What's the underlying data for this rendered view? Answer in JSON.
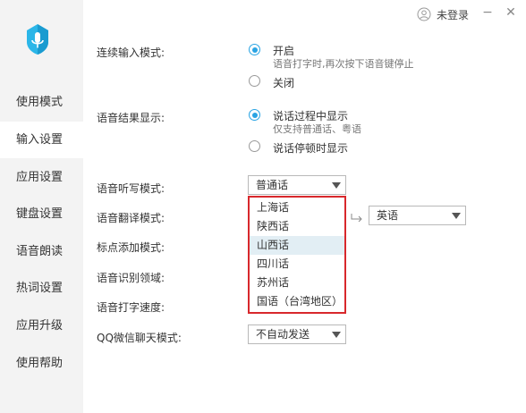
{
  "topbar": {
    "user_label": "未登录",
    "minimize": "−",
    "close": "✕"
  },
  "sidebar": {
    "items": [
      {
        "label": "使用模式",
        "active": false
      },
      {
        "label": "输入设置",
        "active": true
      },
      {
        "label": "应用设置",
        "active": false
      },
      {
        "label": "键盘设置",
        "active": false
      },
      {
        "label": "语音朗读",
        "active": false
      },
      {
        "label": "热词设置",
        "active": false
      },
      {
        "label": "应用升级",
        "active": false
      },
      {
        "label": "使用帮助",
        "active": false
      }
    ]
  },
  "settings": {
    "continuous_input": {
      "label": "连续输入模式:",
      "options": [
        {
          "text": "开启",
          "sub": "语音打字时,再次按下语音键停止",
          "checked": true
        },
        {
          "text": "关闭",
          "sub": "",
          "checked": false
        }
      ]
    },
    "result_display": {
      "label": "语音结果显示:",
      "options": [
        {
          "text": "说话过程中显示",
          "sub": "仅支持普通话、粤语",
          "checked": true
        },
        {
          "text": "说话停顿时显示",
          "sub": "",
          "checked": false
        }
      ]
    },
    "dictation_mode": {
      "label": "语音听写模式:",
      "value": "普通话"
    },
    "translation_mode": {
      "label": "语音翻译模式:",
      "target_value": "英语"
    },
    "punctuation_mode": {
      "label": "标点添加模式:"
    },
    "recognition_domain": {
      "label": "语音识别领域:"
    },
    "typing_speed": {
      "label": "语音打字速度:"
    },
    "qq_wechat_mode": {
      "label": "QQ微信聊天模式:",
      "value": "不自动发送"
    }
  },
  "dropdown": {
    "items": [
      {
        "label": "上海话",
        "highlight": false
      },
      {
        "label": "陕西话",
        "highlight": false
      },
      {
        "label": "山西话",
        "highlight": true
      },
      {
        "label": "四川话",
        "highlight": false
      },
      {
        "label": "苏州话",
        "highlight": false
      },
      {
        "label": "国语（台湾地区）",
        "highlight": false
      }
    ]
  },
  "colors": {
    "accent": "#2aa4e3",
    "highlight_border": "#d8282c",
    "sidebar_bg": "#f3f3f3",
    "logo": "#2bb6e8"
  },
  "icons": {
    "logo": "app-logo-icon",
    "user": "user-icon"
  }
}
